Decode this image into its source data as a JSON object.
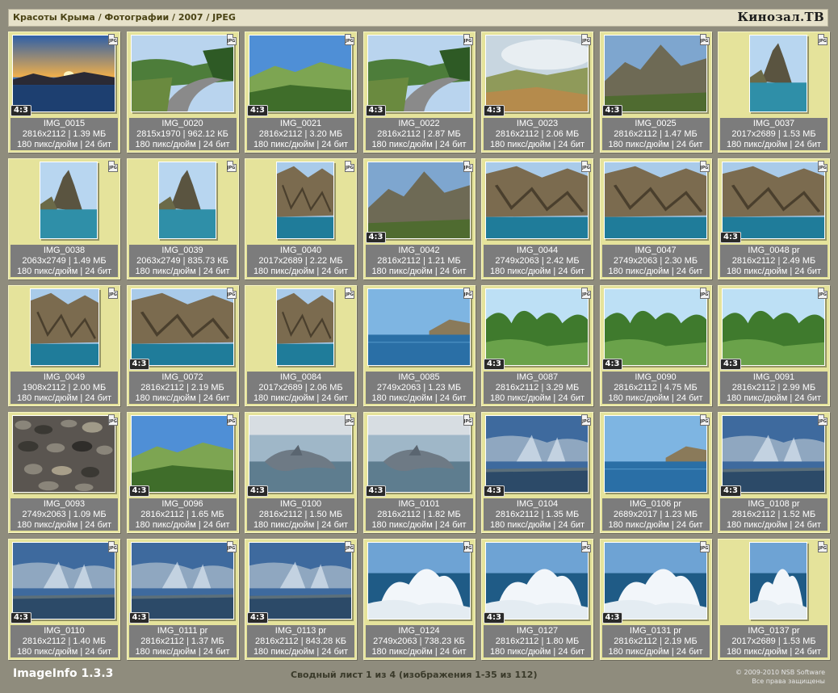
{
  "header": {
    "breadcrumb": "Красоты Крыма / Фотографии / 2007 / JPEG",
    "brand": "Кинозал.ТВ"
  },
  "footer": {
    "app_name": "ImageInfo 1.3.3",
    "summary": "Сводный лист 1 из 4 (изображения 1-35 из 112)",
    "copyright": "© 2009-2010 NSB Software",
    "rights": "Все права защищены"
  },
  "file_type_badge": "JPG",
  "thumbnails": [
    {
      "name": "IMG_0015",
      "dims": "2816x2112 | 1.39 МБ",
      "meta": "180 пикс/дюйм | 24 бит",
      "ratio": "4:3",
      "scene": "sunset",
      "orient": "landscape"
    },
    {
      "name": "IMG_0020",
      "dims": "2815x1970 | 962.12 КБ",
      "meta": "180 пикс/дюйм | 24 бит",
      "ratio": "",
      "scene": "road",
      "orient": "landscape"
    },
    {
      "name": "IMG_0021",
      "dims": "2816x2112 | 3.20 МБ",
      "meta": "180 пикс/дюйм | 24 бит",
      "ratio": "4:3",
      "scene": "hills",
      "orient": "landscape"
    },
    {
      "name": "IMG_0022",
      "dims": "2816x2112 | 2.87 МБ",
      "meta": "180 пикс/дюйм | 24 бит",
      "ratio": "4:3",
      "scene": "road",
      "orient": "landscape"
    },
    {
      "name": "IMG_0023",
      "dims": "2816x2112 | 2.06 МБ",
      "meta": "180 пикс/дюйм | 24 бит",
      "ratio": "4:3",
      "scene": "mist",
      "orient": "landscape"
    },
    {
      "name": "IMG_0025",
      "dims": "2816x2112 | 1.47 МБ",
      "meta": "180 пикс/дюйм | 24 бит",
      "ratio": "4:3",
      "scene": "mountain",
      "orient": "landscape"
    },
    {
      "name": "IMG_0037",
      "dims": "2017x2689 | 1.53 МБ",
      "meta": "180 пикс/дюйм | 24 бит",
      "ratio": "",
      "scene": "rock",
      "orient": "portrait"
    },
    {
      "name": "IMG_0038",
      "dims": "2063x2749 | 1.49 МБ",
      "meta": "180 пикс/дюйм | 24 бит",
      "ratio": "",
      "scene": "rock",
      "orient": "portrait"
    },
    {
      "name": "IMG_0039",
      "dims": "2063x2749 | 835.73 КБ",
      "meta": "180 пикс/дюйм | 24 бит",
      "ratio": "",
      "scene": "rock",
      "orient": "portrait"
    },
    {
      "name": "IMG_0040",
      "dims": "2017x2689 | 2.22 МБ",
      "meta": "180 пикс/дюйм | 24 бит",
      "ratio": "",
      "scene": "cliff",
      "orient": "portrait"
    },
    {
      "name": "IMG_0042",
      "dims": "2816x2112 | 1.21 МБ",
      "meta": "180 пикс/дюйм | 24 бит",
      "ratio": "4:3",
      "scene": "mountain",
      "orient": "landscape"
    },
    {
      "name": "IMG_0044",
      "dims": "2749x2063 | 2.42 МБ",
      "meta": "180 пикс/дюйм | 24 бит",
      "ratio": "",
      "scene": "cliff",
      "orient": "landscape"
    },
    {
      "name": "IMG_0047",
      "dims": "2749x2063 | 2.30 МБ",
      "meta": "180 пикс/дюйм | 24 бит",
      "ratio": "",
      "scene": "cliff",
      "orient": "landscape"
    },
    {
      "name": "IMG_0048 pr",
      "dims": "2816x2112 | 2.49 МБ",
      "meta": "180 пикс/дюйм | 24 бит",
      "ratio": "4:3",
      "scene": "cliff",
      "orient": "landscape"
    },
    {
      "name": "IMG_0049",
      "dims": "1908x2112 | 2.00 МБ",
      "meta": "180 пикс/дюйм | 24 бит",
      "ratio": "",
      "scene": "cliff",
      "orient": "square"
    },
    {
      "name": "IMG_0072",
      "dims": "2816x2112 | 2.19 МБ",
      "meta": "180 пикс/дюйм | 24 бит",
      "ratio": "4:3",
      "scene": "cliff",
      "orient": "landscape"
    },
    {
      "name": "IMG_0084",
      "dims": "2017x2689 | 2.06 МБ",
      "meta": "180 пикс/дюйм | 24 бит",
      "ratio": "",
      "scene": "cliff",
      "orient": "portrait"
    },
    {
      "name": "IMG_0085",
      "dims": "2749x2063 | 1.23 МБ",
      "meta": "180 пикс/дюйм | 24 бит",
      "ratio": "",
      "scene": "sea",
      "orient": "landscape"
    },
    {
      "name": "IMG_0087",
      "dims": "2816x2112 | 3.29 МБ",
      "meta": "180 пикс/дюйм | 24 бит",
      "ratio": "4:3",
      "scene": "trees",
      "orient": "landscape"
    },
    {
      "name": "IMG_0090",
      "dims": "2816x2112 | 4.75 МБ",
      "meta": "180 пикс/дюйм | 24 бит",
      "ratio": "4:3",
      "scene": "trees",
      "orient": "landscape"
    },
    {
      "name": "IMG_0091",
      "dims": "2816x2112 | 2.99 МБ",
      "meta": "180 пикс/дюйм | 24 бит",
      "ratio": "4:3",
      "scene": "trees",
      "orient": "landscape"
    },
    {
      "name": "IMG_0093",
      "dims": "2749x2063 | 1.09 МБ",
      "meta": "180 пикс/дюйм | 24 бит",
      "ratio": "",
      "scene": "pebbles",
      "orient": "landscape"
    },
    {
      "name": "IMG_0096",
      "dims": "2816x2112 | 1.65 МБ",
      "meta": "180 пикс/дюйм | 24 бит",
      "ratio": "4:3",
      "scene": "hills",
      "orient": "landscape"
    },
    {
      "name": "IMG_0100",
      "dims": "2816x2112 | 1.50 МБ",
      "meta": "180 пикс/дюйм | 24 бит",
      "ratio": "4:3",
      "scene": "dolphin",
      "orient": "landscape"
    },
    {
      "name": "IMG_0101",
      "dims": "2816x2112 | 1.82 МБ",
      "meta": "180 пикс/дюйм | 24 бит",
      "ratio": "4:3",
      "scene": "dolphin",
      "orient": "landscape"
    },
    {
      "name": "IMG_0104",
      "dims": "2816x2112 | 1.35 МБ",
      "meta": "180 пикс/дюйм | 24 бит",
      "ratio": "4:3",
      "scene": "sky",
      "orient": "landscape"
    },
    {
      "name": "IMG_0106 pr",
      "dims": "2689x2017 | 1.23 МБ",
      "meta": "180 пикс/дюйм | 24 бит",
      "ratio": "",
      "scene": "sea",
      "orient": "landscape"
    },
    {
      "name": "IMG_0108 pr",
      "dims": "2816x2112 | 1.52 МБ",
      "meta": "180 пикс/дюйм | 24 бит",
      "ratio": "4:3",
      "scene": "sky",
      "orient": "landscape"
    },
    {
      "name": "IMG_0110",
      "dims": "2816x2112 | 1.40 МБ",
      "meta": "180 пикс/дюйм | 24 бит",
      "ratio": "4:3",
      "scene": "sky",
      "orient": "landscape"
    },
    {
      "name": "IMG_0111 pr",
      "dims": "2816x2112 | 1.37 МБ",
      "meta": "180 пикс/дюйм | 24 бит",
      "ratio": "4:3",
      "scene": "sky",
      "orient": "landscape"
    },
    {
      "name": "IMG_0113 pr",
      "dims": "2816x2112 | 843.28 КБ",
      "meta": "180 пикс/дюйм | 24 бит",
      "ratio": "4:3",
      "scene": "sky",
      "orient": "landscape"
    },
    {
      "name": "IMG_0124",
      "dims": "2749x2063 | 738.23 КБ",
      "meta": "180 пикс/дюйм | 24 бит",
      "ratio": "",
      "scene": "wave",
      "orient": "landscape"
    },
    {
      "name": "IMG_0127",
      "dims": "2816x2112 | 1.80 МБ",
      "meta": "180 пикс/дюйм | 24 бит",
      "ratio": "4:3",
      "scene": "wave",
      "orient": "landscape"
    },
    {
      "name": "IMG_0131 pr",
      "dims": "2816x2112 | 2.19 МБ",
      "meta": "180 пикс/дюйм | 24 бит",
      "ratio": "4:3",
      "scene": "wave",
      "orient": "landscape"
    },
    {
      "name": "IMG_0137 pr",
      "dims": "2017x2689 | 1.53 МБ",
      "meta": "180 пикс/дюйм | 24 бит",
      "ratio": "",
      "scene": "wave",
      "orient": "portrait"
    }
  ]
}
